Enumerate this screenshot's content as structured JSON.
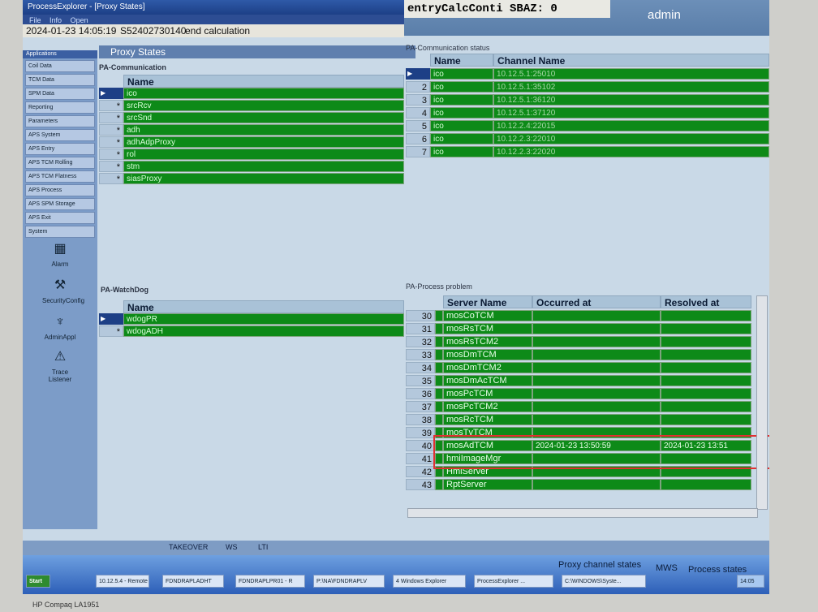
{
  "window": {
    "title": "ProcessExplorer - [Proxy States]",
    "menu": [
      "File",
      "Info",
      "Open"
    ]
  },
  "header": {
    "calc": "entryCalcConti SBAZ: 0",
    "user": "admin"
  },
  "infobar": {
    "datetime": "2024-01-23 14:05:19",
    "id": "S52402730140",
    "status": "end calculation"
  },
  "sidebar": {
    "header": "Applications",
    "items": [
      "Coil Data",
      "TCM Data",
      "SPM Data",
      "Reporting",
      "Parameters",
      "APS System",
      "APS Entry",
      "APS TCM Rolling",
      "APS TCM Flatness",
      "APS Process",
      "APS SPM Storage",
      "APS Exit",
      "System"
    ],
    "icons": [
      {
        "label": "Alarm",
        "icon": "alarm-icon"
      },
      {
        "label": "SecurityConfig",
        "icon": "security-icon"
      },
      {
        "label": "AdminAppl",
        "icon": "admin-icon"
      },
      {
        "label": "Trace Listener",
        "icon": "trace-icon"
      }
    ]
  },
  "page_title": "Proxy States",
  "pa_comm": {
    "label": "PA-Communication",
    "header": "Name",
    "rows": [
      "ico",
      "srcRcv",
      "srcSnd",
      "adh",
      "adhAdpProxy",
      "rol",
      "stm",
      "siasProxy"
    ]
  },
  "pa_comm_status": {
    "label": "PA-Communication status",
    "headers": [
      "Name",
      "Channel Name"
    ],
    "rows": [
      {
        "n": "",
        "name": "ico",
        "channel": "10.12.5.1:25010"
      },
      {
        "n": "2",
        "name": "ico",
        "channel": "10.12.5.1:35102"
      },
      {
        "n": "3",
        "name": "ico",
        "channel": "10.12.5.1:36120"
      },
      {
        "n": "4",
        "name": "ico",
        "channel": "10.12.5.1:37120"
      },
      {
        "n": "5",
        "name": "ico",
        "channel": "10.12.2.4:22015"
      },
      {
        "n": "6",
        "name": "ico",
        "channel": "10.12.2.3:22010"
      },
      {
        "n": "7",
        "name": "ico",
        "channel": "10.12.2.3:22020"
      }
    ]
  },
  "watchdog": {
    "label": "PA-WatchDog",
    "header": "Name",
    "rows": [
      "wdogPR",
      "wdogADH"
    ]
  },
  "process_problem": {
    "label": "PA-Process problem",
    "headers": [
      "Server Name",
      "Occurred at",
      "Resolved at"
    ],
    "rows": [
      {
        "n": "30",
        "server": "mosCoTCM",
        "occ": "",
        "res": ""
      },
      {
        "n": "31",
        "server": "mosRsTCM",
        "occ": "",
        "res": ""
      },
      {
        "n": "32",
        "server": "mosRsTCM2",
        "occ": "",
        "res": ""
      },
      {
        "n": "33",
        "server": "mosDmTCM",
        "occ": "",
        "res": ""
      },
      {
        "n": "34",
        "server": "mosDmTCM2",
        "occ": "",
        "res": ""
      },
      {
        "n": "35",
        "server": "mosDmAcTCM",
        "occ": "",
        "res": ""
      },
      {
        "n": "36",
        "server": "mosPcTCM",
        "occ": "",
        "res": ""
      },
      {
        "n": "37",
        "server": "mosPcTCM2",
        "occ": "",
        "res": ""
      },
      {
        "n": "38",
        "server": "mosRcTCM",
        "occ": "",
        "res": ""
      },
      {
        "n": "39",
        "server": "mosTvTCM",
        "occ": "",
        "res": ""
      },
      {
        "n": "40",
        "server": "mosAdTCM",
        "occ": "2024-01-23 13:50:59",
        "res": "2024-01-23 13:51"
      },
      {
        "n": "41",
        "server": "hmiImageMgr",
        "occ": "",
        "res": ""
      },
      {
        "n": "42",
        "server": "HmiServer",
        "occ": "",
        "res": ""
      },
      {
        "n": "43",
        "server": "RptServer",
        "occ": "",
        "res": ""
      }
    ]
  },
  "statusbar": {
    "items": [
      "TAKEOVER",
      "WS",
      "LTI"
    ]
  },
  "legend": {
    "items": [
      "Proxy channel states",
      "MWS",
      "Process states"
    ]
  },
  "taskbar": {
    "start": "Start",
    "tasks": [
      "10.12.5.4 - Remote D",
      "FDNDRAPLADHT",
      "FDNDRAPLPR01 - R",
      "P:\\NA\\FDNDRAPLV",
      "4 Windows Explorer",
      "ProcessExplorer ...",
      "C:\\WINDOWS\\Syste..."
    ],
    "clock": "14:05"
  },
  "monitor_label": "HP Compaq LA1951"
}
